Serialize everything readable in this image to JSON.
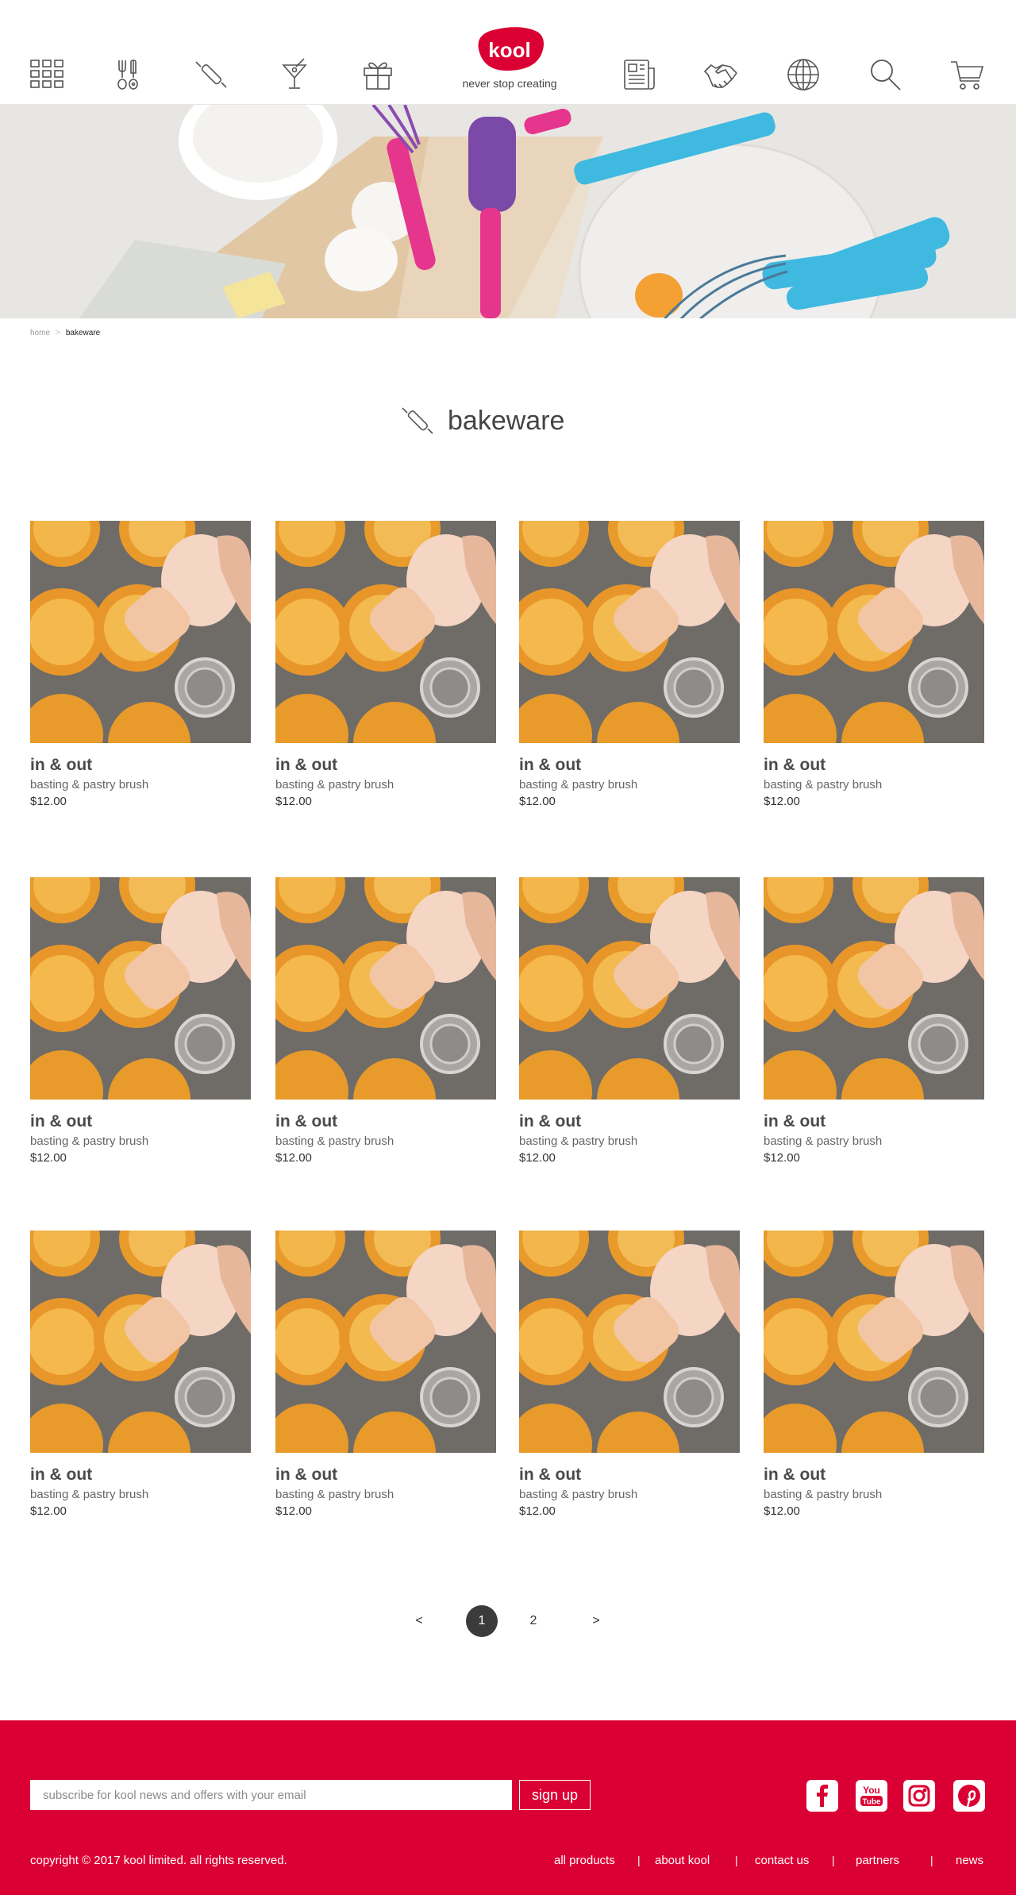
{
  "header": {
    "logo_text": "kool",
    "tagline": "never stop creating",
    "nav_left": [
      "grid-icon",
      "utensils-icon",
      "rolling-pin-icon",
      "cocktail-icon",
      "gift-icon"
    ],
    "nav_right": [
      "news-icon",
      "handshake-icon",
      "globe-icon",
      "search-icon",
      "cart-icon"
    ]
  },
  "breadcrumb": {
    "home": "home",
    "separator": ">",
    "current": "bakeware"
  },
  "page": {
    "title": "bakeware",
    "title_icon": "rolling-pin-icon"
  },
  "products": [
    {
      "name": "in & out",
      "desc": "basting & pastry brush",
      "price": "$12.00"
    },
    {
      "name": "in & out",
      "desc": "basting & pastry brush",
      "price": "$12.00"
    },
    {
      "name": "in & out",
      "desc": "basting & pastry brush",
      "price": "$12.00"
    },
    {
      "name": "in & out",
      "desc": "basting & pastry brush",
      "price": "$12.00"
    },
    {
      "name": "in & out",
      "desc": "basting & pastry brush",
      "price": "$12.00"
    },
    {
      "name": "in & out",
      "desc": "basting & pastry brush",
      "price": "$12.00"
    },
    {
      "name": "in & out",
      "desc": "basting & pastry brush",
      "price": "$12.00"
    },
    {
      "name": "in & out",
      "desc": "basting & pastry brush",
      "price": "$12.00"
    },
    {
      "name": "in & out",
      "desc": "basting & pastry brush",
      "price": "$12.00"
    },
    {
      "name": "in & out",
      "desc": "basting & pastry brush",
      "price": "$12.00"
    },
    {
      "name": "in & out",
      "desc": "basting & pastry brush",
      "price": "$12.00"
    },
    {
      "name": "in & out",
      "desc": "basting & pastry brush",
      "price": "$12.00"
    }
  ],
  "pagination": {
    "prev": "<",
    "pages": [
      "1",
      "2"
    ],
    "current": "1",
    "next": ">"
  },
  "footer": {
    "subscribe_placeholder": "subscribe for kool news and offers with your email",
    "signup_label": "sign up",
    "social": [
      "facebook-icon",
      "youtube-icon",
      "instagram-icon",
      "pinterest-icon"
    ],
    "youtube_text_1": "You",
    "youtube_text_2": "Tube",
    "copyright": "copyright © 2017 kool limited. all rights reserved.",
    "links": [
      "all products",
      "about kool",
      "contact us",
      "partners",
      "news"
    ],
    "link_separator": "|"
  },
  "colors": {
    "brand_red": "#db0033",
    "text_dark": "#333333",
    "pager_active": "#3b3b3b"
  }
}
